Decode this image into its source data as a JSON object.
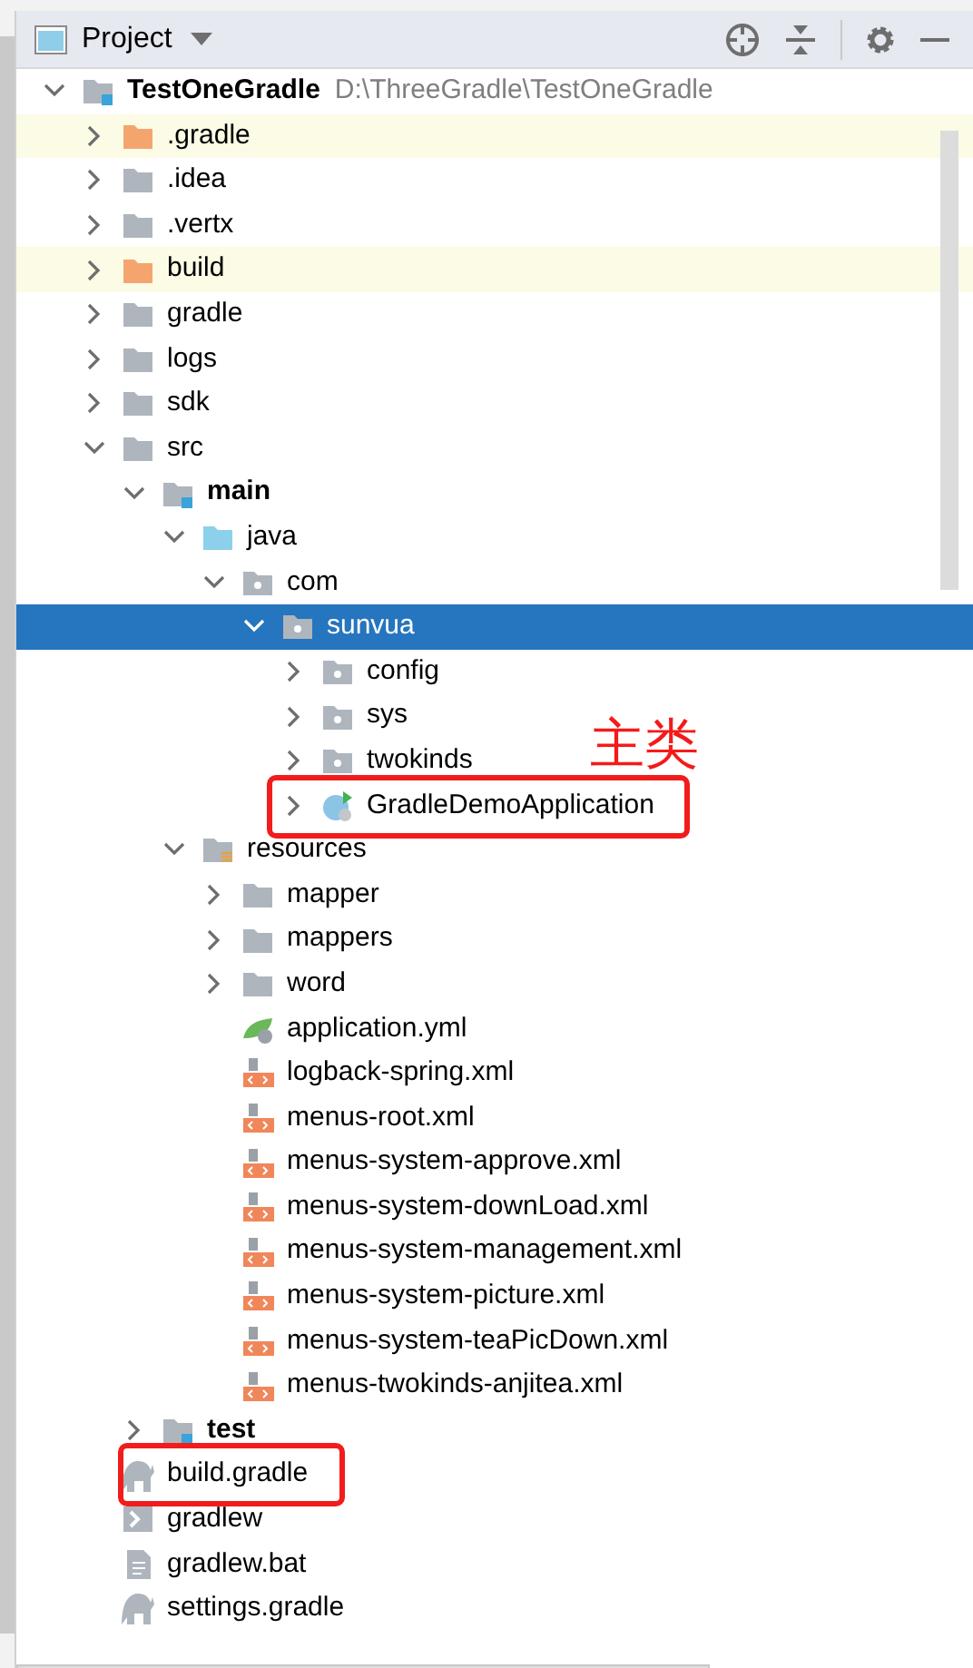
{
  "panel": {
    "title": "Project"
  },
  "callout": "主类",
  "tree": [
    {
      "name": "TestOneGradle",
      "path": "D:\\ThreeGradle\\TestOneGradle",
      "kind": "module",
      "expanded": true,
      "selected": false,
      "children": [
        {
          "name": ".gradle",
          "kind": "excluded",
          "expanded": false,
          "selected": false
        },
        {
          "name": ".idea",
          "kind": "folder",
          "expanded": false,
          "selected": false
        },
        {
          "name": ".vertx",
          "kind": "folder",
          "expanded": false,
          "selected": false
        },
        {
          "name": "build",
          "kind": "excluded",
          "expanded": false,
          "selected": false
        },
        {
          "name": "gradle",
          "kind": "folder",
          "expanded": false,
          "selected": false
        },
        {
          "name": "logs",
          "kind": "folder",
          "expanded": false,
          "selected": false
        },
        {
          "name": "sdk",
          "kind": "folder",
          "expanded": false,
          "selected": false
        },
        {
          "name": "src",
          "kind": "folder",
          "expanded": true,
          "selected": false,
          "children": [
            {
              "name": "main",
              "kind": "module",
              "expanded": true,
              "selected": false,
              "children": [
                {
                  "name": "java",
                  "kind": "source",
                  "expanded": true,
                  "selected": false,
                  "children": [
                    {
                      "name": "com",
                      "kind": "package",
                      "expanded": true,
                      "selected": false,
                      "children": [
                        {
                          "name": "sunvua",
                          "kind": "package",
                          "expanded": true,
                          "selected": true,
                          "children": [
                            {
                              "name": "config",
                              "kind": "package",
                              "expanded": false,
                              "selected": false
                            },
                            {
                              "name": "sys",
                              "kind": "package",
                              "expanded": false,
                              "selected": false
                            },
                            {
                              "name": "twokinds",
                              "kind": "package",
                              "expanded": false,
                              "selected": false
                            },
                            {
                              "name": "GradleDemoApplication",
                              "kind": "class",
                              "expanded": false,
                              "selected": false,
                              "outlined": true
                            }
                          ]
                        }
                      ]
                    }
                  ]
                },
                {
                  "name": "resources",
                  "kind": "resources",
                  "expanded": true,
                  "selected": false,
                  "children": [
                    {
                      "name": "mapper",
                      "kind": "folder",
                      "expanded": false,
                      "selected": false
                    },
                    {
                      "name": "mappers",
                      "kind": "folder",
                      "expanded": false,
                      "selected": false
                    },
                    {
                      "name": "word",
                      "kind": "folder",
                      "expanded": false,
                      "selected": false
                    },
                    {
                      "name": "application.yml",
                      "kind": "yml",
                      "selected": false
                    },
                    {
                      "name": "logback-spring.xml",
                      "kind": "xml",
                      "selected": false
                    },
                    {
                      "name": "menus-root.xml",
                      "kind": "xml",
                      "selected": false
                    },
                    {
                      "name": "menus-system-approve.xml",
                      "kind": "xml",
                      "selected": false
                    },
                    {
                      "name": "menus-system-downLoad.xml",
                      "kind": "xml",
                      "selected": false
                    },
                    {
                      "name": "menus-system-management.xml",
                      "kind": "xml",
                      "selected": false
                    },
                    {
                      "name": "menus-system-picture.xml",
                      "kind": "xml",
                      "selected": false
                    },
                    {
                      "name": "menus-system-teaPicDown.xml",
                      "kind": "xml",
                      "selected": false
                    },
                    {
                      "name": "menus-twokinds-anjitea.xml",
                      "kind": "xml",
                      "selected": false
                    }
                  ]
                }
              ]
            },
            {
              "name": "test",
              "kind": "module",
              "expanded": false,
              "selected": false
            }
          ]
        },
        {
          "name": "build.gradle",
          "kind": "gradle",
          "selected": false,
          "outlined": true
        },
        {
          "name": "gradlew",
          "kind": "shell",
          "selected": false
        },
        {
          "name": "gradlew.bat",
          "kind": "bat",
          "selected": false
        },
        {
          "name": "settings.gradle",
          "kind": "gradle",
          "selected": false
        }
      ]
    }
  ]
}
